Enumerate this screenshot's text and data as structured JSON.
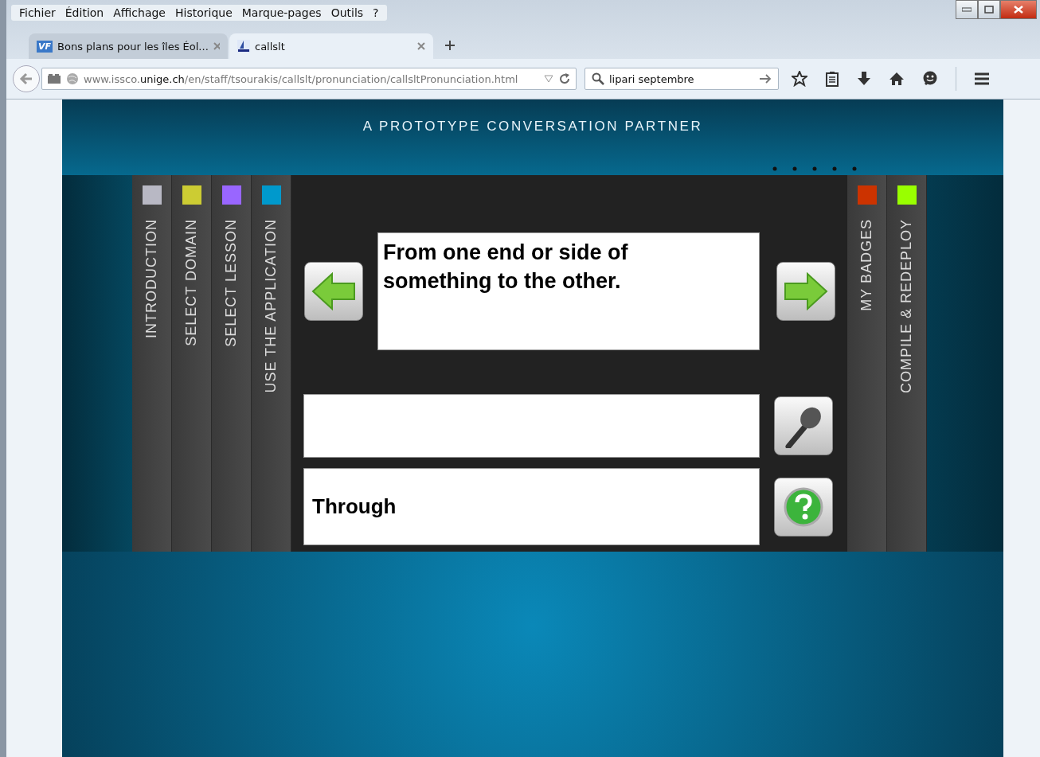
{
  "menu": [
    "Fichier",
    "Édition",
    "Affichage",
    "Historique",
    "Marque-pages",
    "Outils",
    "?"
  ],
  "tabs": [
    {
      "label": "Bons plans pour les îles Éol...",
      "selected": false,
      "icon": "VF"
    },
    {
      "label": "callslt",
      "selected": true
    }
  ],
  "address": "www.issco.**unige.ch**/en/staff/tsourakis/callslt/pronunciation/callsltPronunciation.html",
  "search": {
    "value": "lipari septembre"
  },
  "page": {
    "header": "A PROTOTYPE CONVERSATION PARTNER",
    "left_tabs": [
      {
        "label": "INTRODUCTION",
        "color": "#b8b8c4"
      },
      {
        "label": "SELECT DOMAIN",
        "color": "#cccc33"
      },
      {
        "label": "SELECT LESSON",
        "color": "#9966ff"
      },
      {
        "label": "USE THE APPLICATION",
        "color": "#0099cc"
      }
    ],
    "right_tabs": [
      {
        "label": "MY BADGES",
        "color": "#cc3300"
      },
      {
        "label": "COMPILE & REDEPLOY",
        "color": "#99ff00"
      }
    ],
    "prompt": "From one end or side of something to the other.",
    "answer": "Through"
  }
}
